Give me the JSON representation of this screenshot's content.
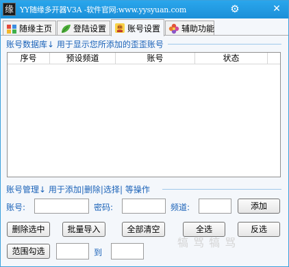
{
  "window": {
    "title": "YY随缘多开器V3A  -软件官网:www.yysyuan.com",
    "app_icon_char": "缘",
    "settings_glyph": "⚙",
    "close_glyph": "✕"
  },
  "tabs": [
    {
      "label": "随缘主页",
      "icon": "colored-blocks-icon",
      "active": false
    },
    {
      "label": "登陆设置",
      "icon": "leaf-icon",
      "active": false
    },
    {
      "label": "账号设置",
      "icon": "character-icon",
      "active": true
    },
    {
      "label": "辅助功能",
      "icon": "flower-icon",
      "active": false
    }
  ],
  "account_db": {
    "title": "账号数据库↓  用于显示您所添加的歪歪账号"
  },
  "table": {
    "columns": [
      "序号",
      "预设频道",
      "账号",
      "状态"
    ],
    "rows": []
  },
  "account_mgmt": {
    "title": "账号管理↓  用于添加|删除|选择| 等操作"
  },
  "form": {
    "account_label": "账号:",
    "account_value": "",
    "password_label": "密码:",
    "password_value": "",
    "channel_label": "频道:",
    "channel_value": "",
    "add_button": "添加"
  },
  "actions": {
    "delete_selected": "删除选中",
    "batch_import": "批量导入",
    "clear_all": "全部清空",
    "select_all": "全选",
    "invert_select": "反选"
  },
  "range": {
    "range_select_button": "范围勾选",
    "from_value": "",
    "to_label": "到",
    "to_value": ""
  },
  "watermark": "犒 骂 犒 骂",
  "colors": {
    "titlebar": "#1b8fd8",
    "section_text": "#1a62b8",
    "window_bg": "#f4f7fb"
  }
}
